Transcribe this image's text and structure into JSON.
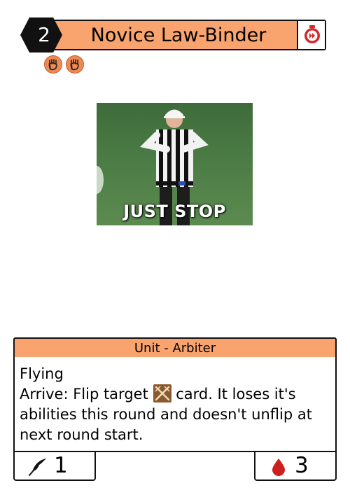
{
  "card": {
    "cost": "2",
    "name": "Novice Law-Binder",
    "speed_icon": "fast-forward-clock-icon",
    "keyword_icons": [
      "hand-icon",
      "hand-icon"
    ],
    "art_caption": "JUST STOP",
    "type_line": "Unit - Arbiter",
    "rules": {
      "line1": "Flying",
      "line2_before": "Arrive: Flip target",
      "line2_icon": "crossed-swords-icon",
      "line2_after": "card. It loses it's abilities this round and doesn't unflip at next round start."
    },
    "power": "1",
    "health": "3"
  },
  "colors": {
    "accent": "#f9a46e",
    "cost_bg": "#111111",
    "health": "#cc1f1f",
    "speed": "#d32929"
  }
}
